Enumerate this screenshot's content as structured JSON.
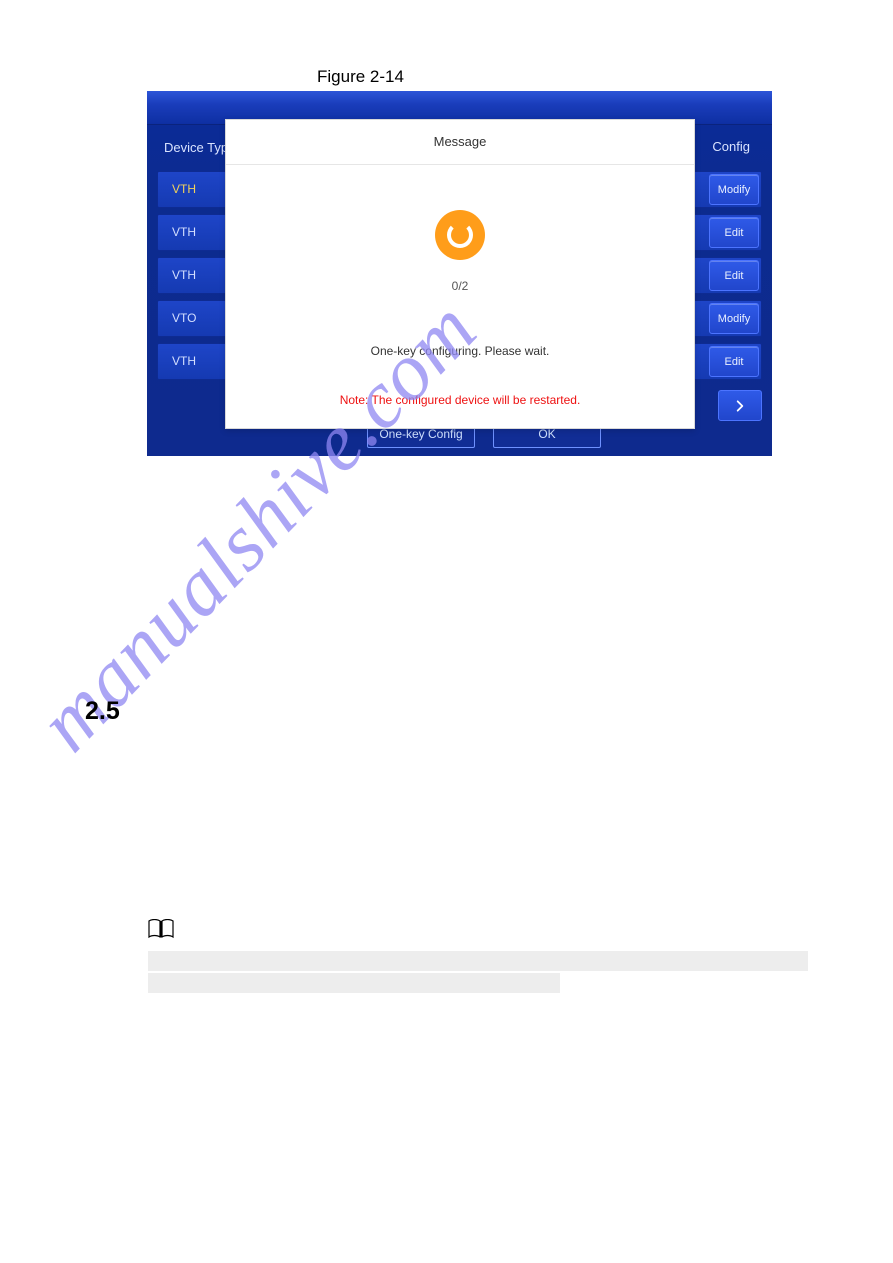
{
  "figure_caption": "Figure 2-14",
  "panel": {
    "header_left": "Device Type",
    "header_right": "Config",
    "rows": [
      {
        "type": "VTH",
        "action": "Modify"
      },
      {
        "type": "VTH",
        "action": "Edit"
      },
      {
        "type": "VTH",
        "action": "Edit"
      },
      {
        "type": "VTO",
        "action": "Modify"
      },
      {
        "type": "VTH",
        "action": "Edit"
      }
    ],
    "bottom_buttons": {
      "one_key": "One-key Config",
      "ok": "OK"
    }
  },
  "modal": {
    "title": "Message",
    "progress": "0/2",
    "wait": "One-key configuring. Please wait.",
    "note": "Note: The configured device will be restarted."
  },
  "section_number": "2.5",
  "watermark": "manualshive.com"
}
